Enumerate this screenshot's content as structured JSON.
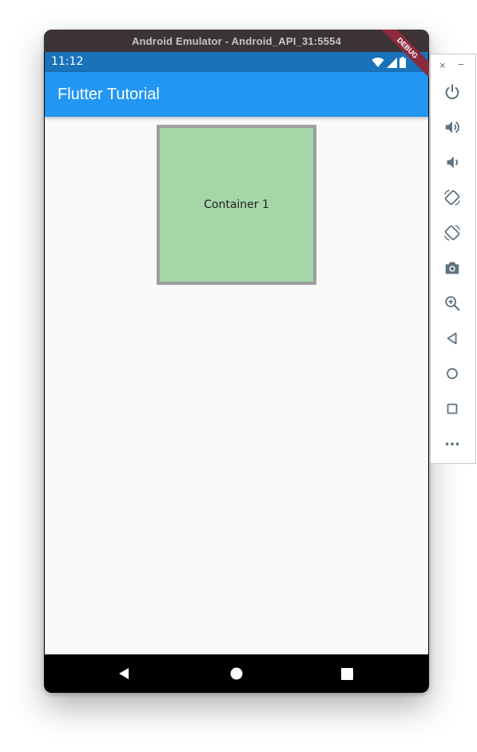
{
  "window": {
    "title": "Android Emulator - Android_API_31:5554"
  },
  "status_bar": {
    "time": "11:12",
    "icons": [
      "wifi-icon",
      "signal-icon",
      "battery-icon"
    ]
  },
  "app_bar": {
    "title": "Flutter Tutorial",
    "debug_banner": "DEBUG"
  },
  "body": {
    "container_label": "Container 1",
    "container_color": "#a5d6a7",
    "container_border_color": "#9e9e9e"
  },
  "nav_bar": {
    "buttons": [
      "back-icon",
      "home-icon",
      "recents-icon"
    ]
  },
  "side_toolbar": {
    "close_label": "×",
    "minimize_label": "−",
    "tools": [
      "power-icon",
      "volume-up-icon",
      "volume-down-icon",
      "rotate-left-icon",
      "rotate-right-icon",
      "camera-icon",
      "zoom-icon",
      "back-icon",
      "home-icon",
      "overview-icon",
      "more-icon"
    ]
  },
  "colors": {
    "app_bar": "#2196f3",
    "status_bar": "#1a72bb",
    "title_bar": "#3b3335",
    "tool_icon": "#5f7380"
  }
}
